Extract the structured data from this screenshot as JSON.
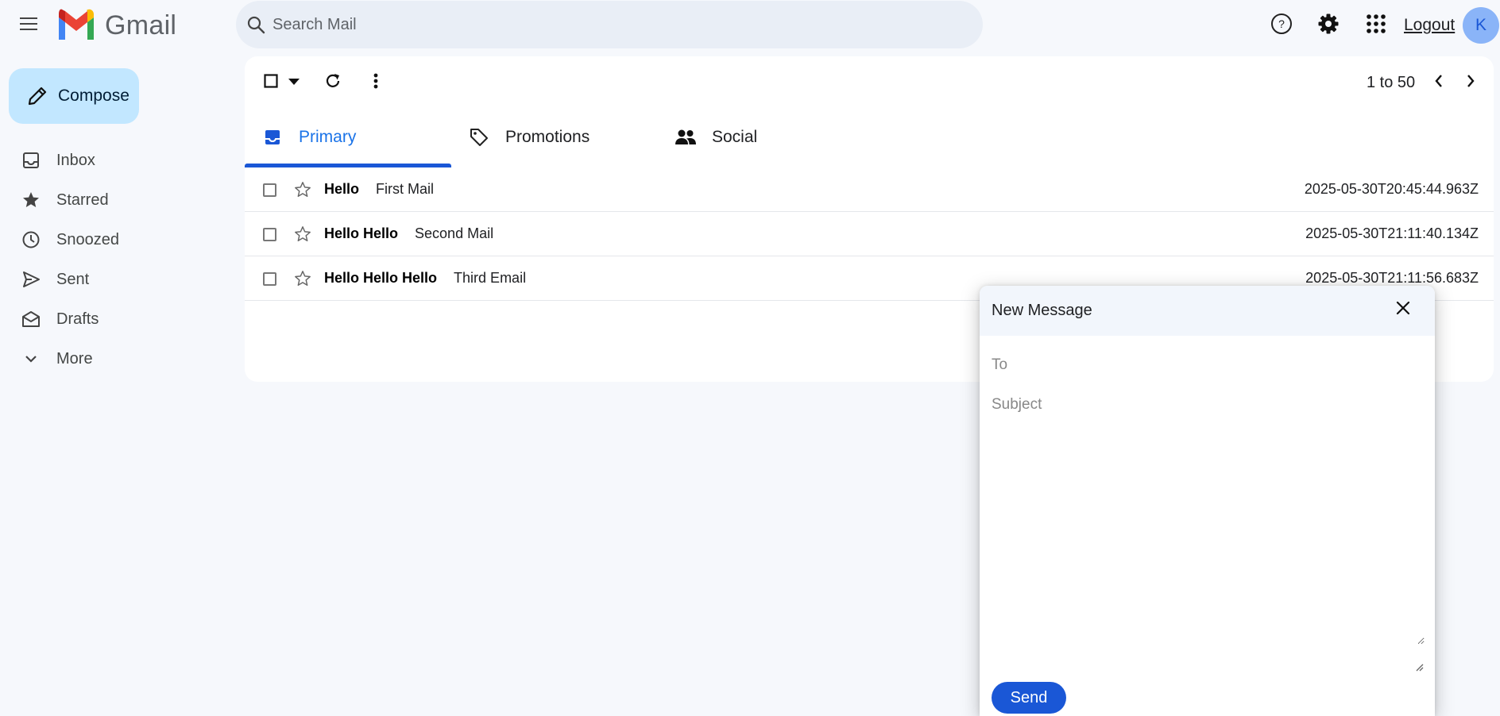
{
  "header": {
    "app_name": "Gmail",
    "search_placeholder": "Search Mail",
    "logout_label": "Logout",
    "avatar_initial": "K",
    "icons": [
      "menu-icon",
      "help-icon",
      "settings-icon",
      "apps-icon"
    ]
  },
  "sidebar": {
    "compose_label": "Compose",
    "items": [
      {
        "label": "Inbox",
        "icon": "inbox-icon"
      },
      {
        "label": "Starred",
        "icon": "star-icon"
      },
      {
        "label": "Snoozed",
        "icon": "clock-icon"
      },
      {
        "label": "Sent",
        "icon": "send-icon"
      },
      {
        "label": "Drafts",
        "icon": "drafts-icon"
      },
      {
        "label": "More",
        "icon": "chevron-down-icon"
      }
    ]
  },
  "toolbar": {
    "pager_text": "1 to 50"
  },
  "tabs": [
    {
      "label": "Primary",
      "icon": "inbox-icon",
      "active": true
    },
    {
      "label": "Promotions",
      "icon": "tag-icon",
      "active": false
    },
    {
      "label": "Social",
      "icon": "people-icon",
      "active": false
    }
  ],
  "emails": [
    {
      "sender": "Hello",
      "subject": "First Mail",
      "date": "2025-05-30T20:45:44.963Z"
    },
    {
      "sender": "Hello Hello",
      "subject": "Second Mail",
      "date": "2025-05-30T21:11:40.134Z"
    },
    {
      "sender": "Hello Hello Hello",
      "subject": "Third Email",
      "date": "2025-05-30T21:11:56.683Z"
    }
  ],
  "compose_window": {
    "title": "New Message",
    "to_placeholder": "To",
    "subject_placeholder": "Subject",
    "send_label": "Send"
  },
  "colors": {
    "background": "#f6f8fc",
    "compose_button": "#c2e7ff",
    "accent_blue": "#1a57d6",
    "active_tab_text": "#1a73e8",
    "search_bg": "#e9eef6"
  }
}
